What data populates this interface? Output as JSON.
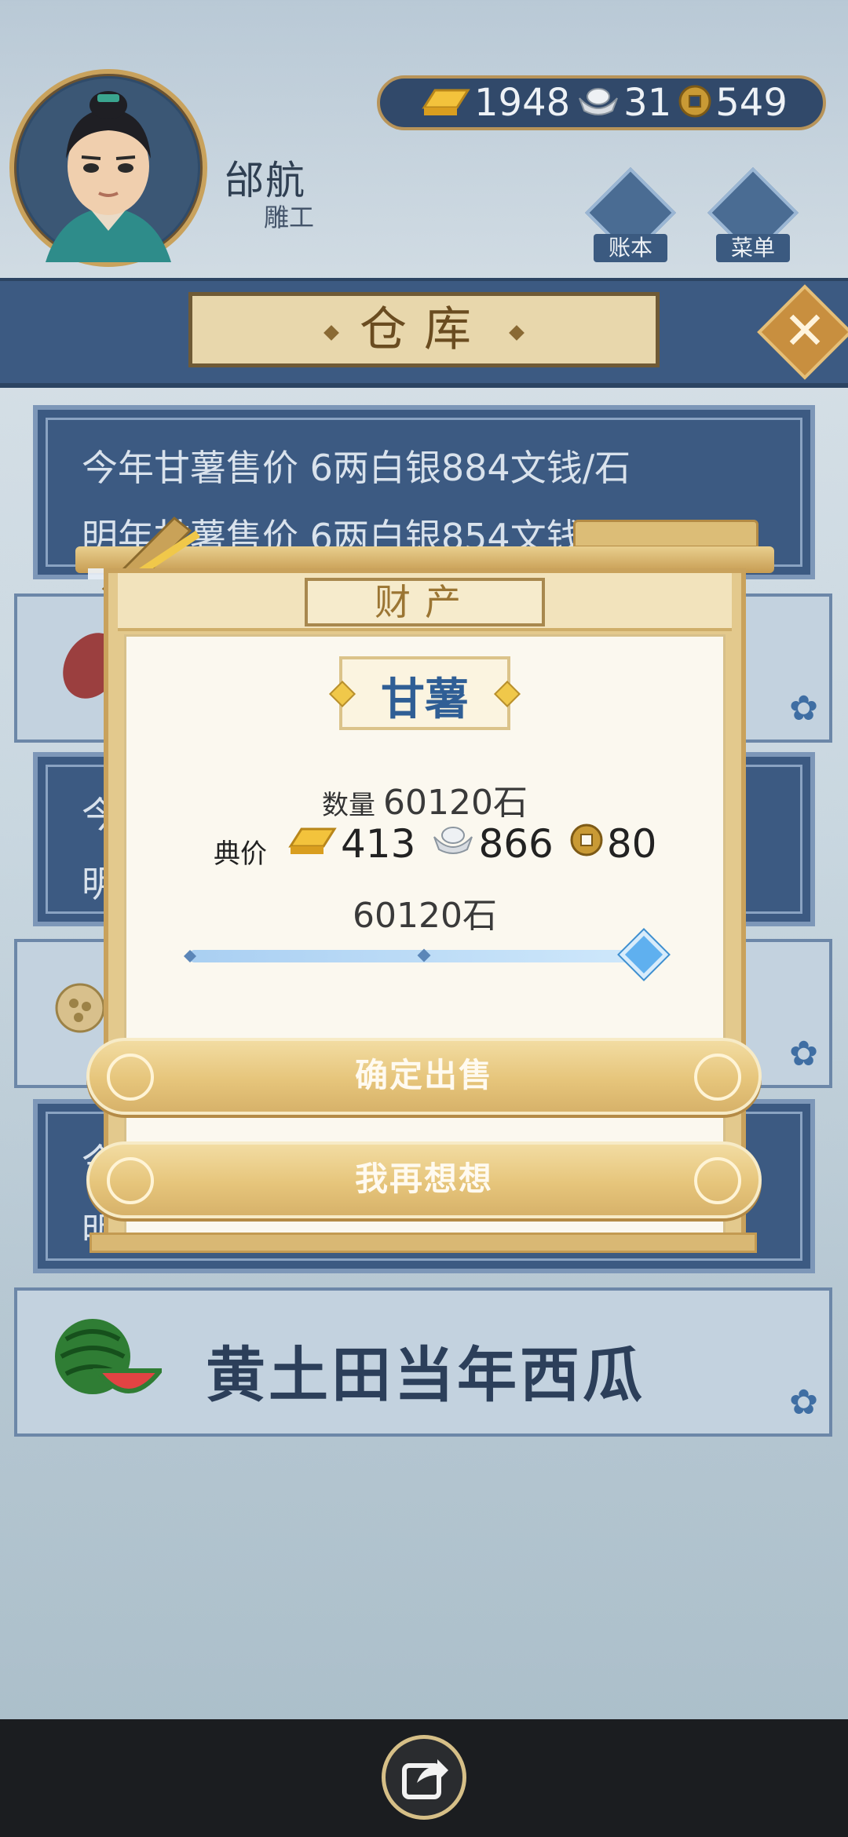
{
  "player": {
    "name": "邰航",
    "title": "雕工"
  },
  "currency": {
    "gold": "1948",
    "silver": "31",
    "copper": "549"
  },
  "header_buttons": {
    "ledger": "账本",
    "menu": "菜单"
  },
  "warehouse": {
    "title": "仓库"
  },
  "background_list": {
    "line_1": "今年甘薯售价 6两白银884文钱/石",
    "line_2": "明年甘薯售价 6两白银854文钱/石",
    "partial_1": "今",
    "partial_2": "明",
    "partial_3": "今",
    "partial_4": "明",
    "watermelon_item": "黄土田当年西瓜"
  },
  "modal": {
    "title": "财产",
    "item_name": "甘薯",
    "quantity_label": "数量",
    "quantity_value": "60120石",
    "price_label": "典价",
    "price_gold": "413",
    "price_silver": "866",
    "price_copper": "80",
    "selected_amount": "60120石",
    "slider_fraction": 1.0,
    "confirm_button": "确定出售",
    "cancel_button": "我再想想"
  },
  "icons": [
    "gold-ingot-icon",
    "silver-ingot-icon",
    "copper-coin-icon",
    "share-icon",
    "close-icon",
    "flower-icon",
    "wheat-bundle-icon",
    "watermelon-icon"
  ],
  "colors": {
    "panel_blue": "#3c5a82",
    "gold": "#e3c98d",
    "item_blue": "#2f5e95",
    "slider_blue": "#5fb0ef"
  }
}
